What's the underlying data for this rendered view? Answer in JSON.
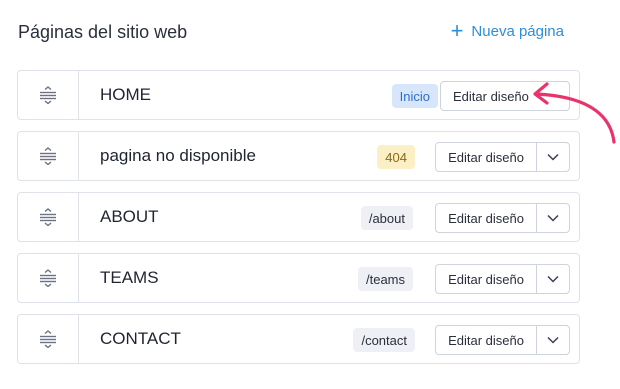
{
  "header": {
    "title": "Páginas del sitio web",
    "new_page_label": "Nueva página"
  },
  "pages": [
    {
      "name": "HOME",
      "badge": "Inicio",
      "edit_label": "Editar diseño"
    },
    {
      "name": "pagina no disponible",
      "badge": "404",
      "edit_label": "Editar diseño"
    },
    {
      "name": "ABOUT",
      "badge": "/about",
      "edit_label": "Editar diseño"
    },
    {
      "name": "TEAMS",
      "badge": "/teams",
      "edit_label": "Editar diseño"
    },
    {
      "name": "CONTACT",
      "badge": "/contact",
      "edit_label": "Editar diseño"
    }
  ],
  "colors": {
    "accent": "#2b8fd8",
    "arrow": "#e8336b",
    "home_badge_bg": "#d8e6fb",
    "error_badge_bg": "#fbefc6"
  }
}
